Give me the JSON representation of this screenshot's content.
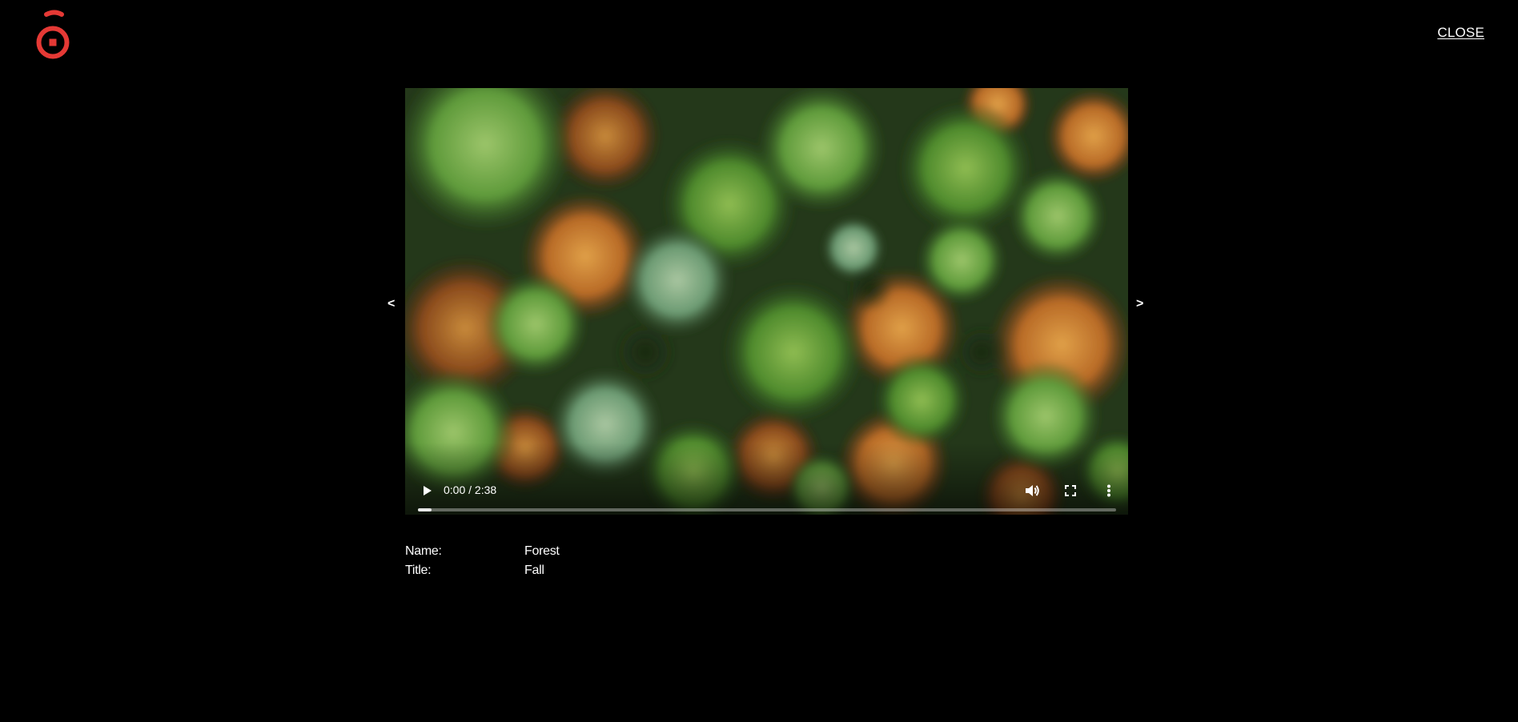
{
  "header": {
    "logo_icon": "brand-logo",
    "brand_color": "#e53935",
    "close_label": "CLOSE"
  },
  "navigation": {
    "prev_label": "<",
    "next_label": ">"
  },
  "player": {
    "frame_description_icon": "aerial-forest-thumbnail",
    "current_time": "0:00",
    "time_separator": " / ",
    "duration": "2:38",
    "progress_fraction": 0.02,
    "icons": {
      "play": "play-icon",
      "volume": "volume-icon",
      "fullscreen": "fullscreen-icon",
      "more": "more-vert-icon"
    }
  },
  "details": {
    "name_label": "Name:",
    "name_value": "Forest",
    "title_label": "Title:",
    "title_value": "Fall"
  }
}
